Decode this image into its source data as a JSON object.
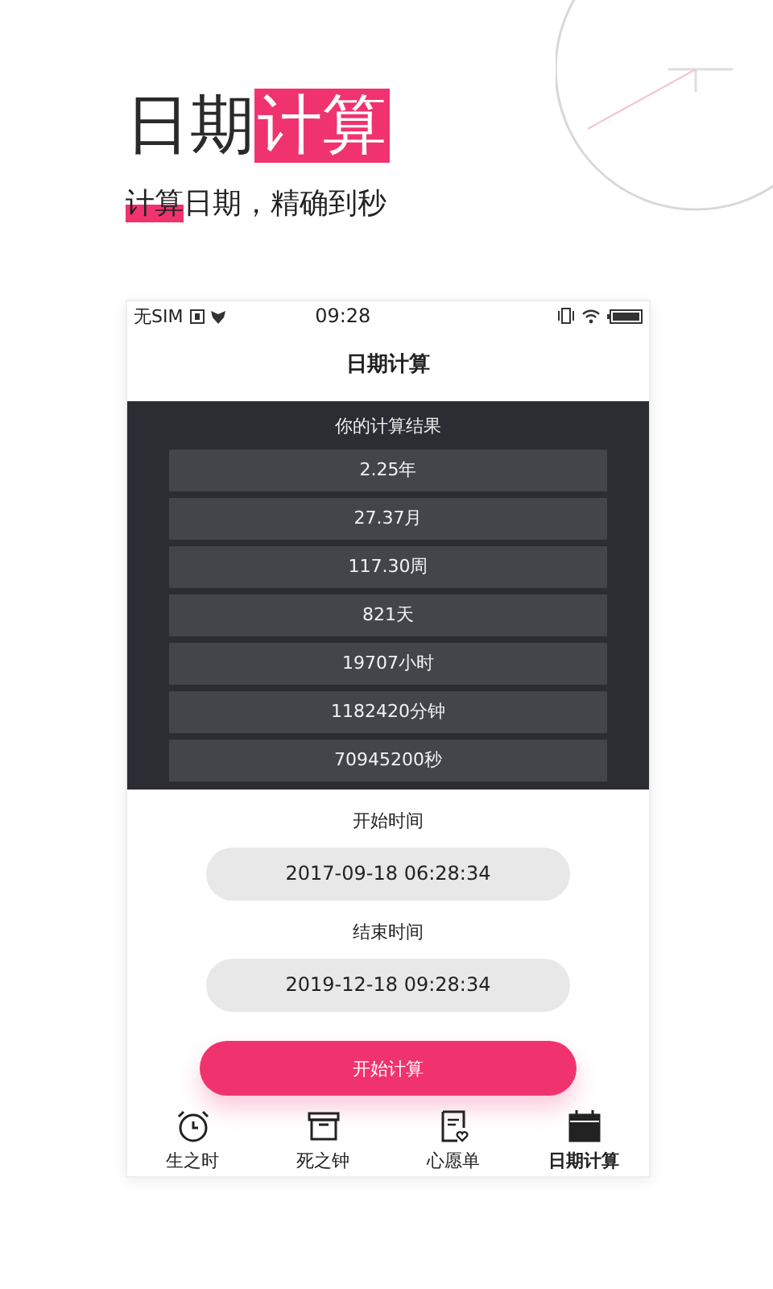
{
  "headline": {
    "plain": "日期",
    "highlight": "计算"
  },
  "subtitle": {
    "highlight": "计算",
    "plain": "日期，精确到秒"
  },
  "status_bar": {
    "carrier": "无SIM",
    "time": "09:28"
  },
  "screen_title": "日期计算",
  "results": {
    "heading": "你的计算结果",
    "items": [
      "2.25年",
      "27.37月",
      "117.30周",
      "821天",
      "19707小时",
      "1182420分钟",
      "70945200秒"
    ]
  },
  "start": {
    "label": "开始时间",
    "value": "2017-09-18 06:28:34"
  },
  "end": {
    "label": "结束时间",
    "value": "2019-12-18 09:28:34"
  },
  "calculate_button": "开始计算",
  "tabs": [
    {
      "label": "生之时",
      "kind": "clock",
      "selected": false
    },
    {
      "label": "死之钟",
      "kind": "box",
      "selected": false
    },
    {
      "label": "心愿单",
      "kind": "list",
      "selected": false
    },
    {
      "label": "日期计算",
      "kind": "calendar",
      "selected": true
    }
  ]
}
